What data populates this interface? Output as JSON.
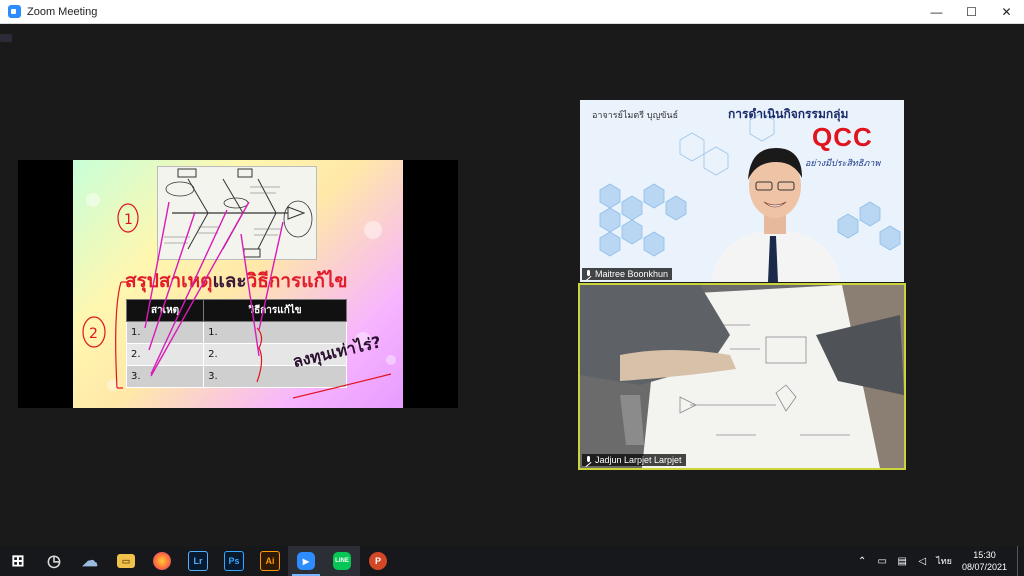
{
  "window": {
    "title": "Zoom Meeting",
    "controls": {
      "minimize": "—",
      "maximize": "☐",
      "close": "✕"
    }
  },
  "shared_slide": {
    "heading_part1": "สรุปสาเหตุ",
    "heading_part2": "และ",
    "heading_part3": "วิธีการแก้ไข",
    "table_headers": [
      "สาเหตุ",
      "วิธีการแก้ไข"
    ],
    "rows": [
      [
        "1.",
        "1."
      ],
      [
        "2.",
        "2."
      ],
      [
        "3.",
        "3."
      ]
    ],
    "handwritten_cost": "ลงทุนเท่าไร่?",
    "handwritten_marks": [
      "1",
      "2"
    ]
  },
  "participants": [
    {
      "name": "Maitree Boonkhun",
      "background_top_name": "อาจารย์ไมตรี บุญขันธ์",
      "background_title": "การดำเนินกิจกรรมกลุ่ม",
      "background_brand": "QCC",
      "background_subtitle": "อย่างมีประสิทธิภาพ"
    },
    {
      "name": "Jadjun Larpjet Larpjet",
      "active_speaker": true
    }
  ],
  "taskbar": {
    "apps": [
      {
        "name": "windows-start",
        "glyph": "⊞"
      },
      {
        "name": "clock-app",
        "glyph": "◷"
      },
      {
        "name": "weather",
        "glyph": "☁"
      },
      {
        "name": "file-explorer",
        "glyph": "▭"
      },
      {
        "name": "firefox",
        "glyph": "●"
      },
      {
        "name": "lightroom",
        "glyph": "Lr"
      },
      {
        "name": "photoshop",
        "glyph": "Ps"
      },
      {
        "name": "illustrator",
        "glyph": "Ai"
      },
      {
        "name": "zoom",
        "glyph": "▶"
      },
      {
        "name": "line",
        "glyph": "LINE"
      },
      {
        "name": "powerpoint",
        "glyph": "P"
      }
    ],
    "tray_language": "ไทย",
    "time": "15:30",
    "date": "08/07/2021"
  },
  "colors": {
    "zoom_blue": "#2d8cff",
    "active_speaker_border": "#c9d53a",
    "slide_heading_red": "#e21c2a",
    "taskbar_bg": "#16181c"
  }
}
